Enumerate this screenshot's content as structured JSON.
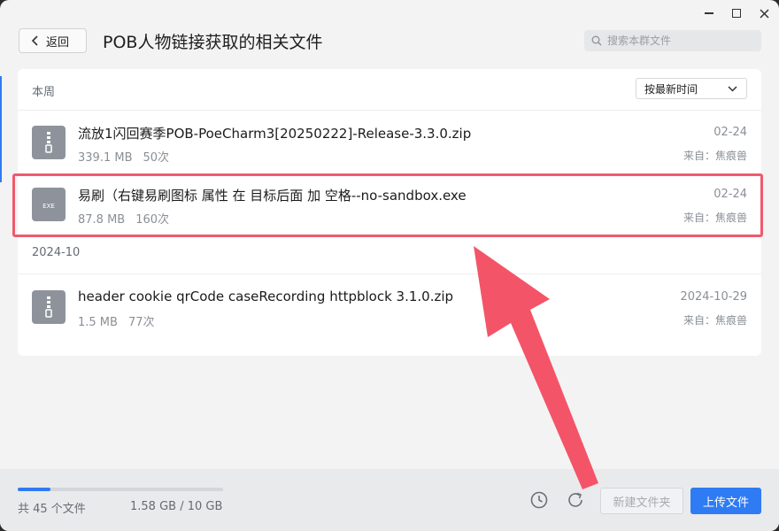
{
  "window": {
    "controls": [
      "minimize",
      "maximize",
      "close"
    ]
  },
  "header": {
    "back_label": "返回",
    "title": "POB人物链接获取的相关文件",
    "search_placeholder": "搜索本群文件"
  },
  "list": {
    "sort_label": "按最新时间",
    "sections": [
      {
        "label": "本周",
        "files": [
          {
            "name": "流放1闪回赛季POB-PoeCharm3[20250222]-Release-3.3.0.zip",
            "size": "339.1 MB",
            "downloads": "50次",
            "date": "02-24",
            "from": "来自：焦痕兽",
            "icon": "zip-icon"
          },
          {
            "name": "易刷（右键易刷图标 属性 在 目标后面 加 空格--no-sandbox.exe",
            "size": "87.8 MB",
            "downloads": "160次",
            "date": "02-24",
            "from": "来自：焦痕兽",
            "icon": "exe-icon",
            "icon_text": "EXE"
          }
        ]
      },
      {
        "label": "2024-10",
        "files": [
          {
            "name": "header cookie qrCode caseRecording httpblock 3.1.0.zip",
            "size": "1.5 MB",
            "downloads": "77次",
            "date": "2024-10-29",
            "from": "来自：焦痕兽",
            "icon": "zip-icon"
          }
        ]
      }
    ]
  },
  "footer": {
    "file_count": "共 45 个文件",
    "storage": "1.58 GB / 10 GB",
    "storage_fraction": 0.158,
    "new_folder_label": "新建文件夹",
    "upload_label": "上传文件"
  },
  "colors": {
    "accent": "#2f7bf3",
    "highlight": "#ef5a6c",
    "arrow": "#f45468"
  }
}
